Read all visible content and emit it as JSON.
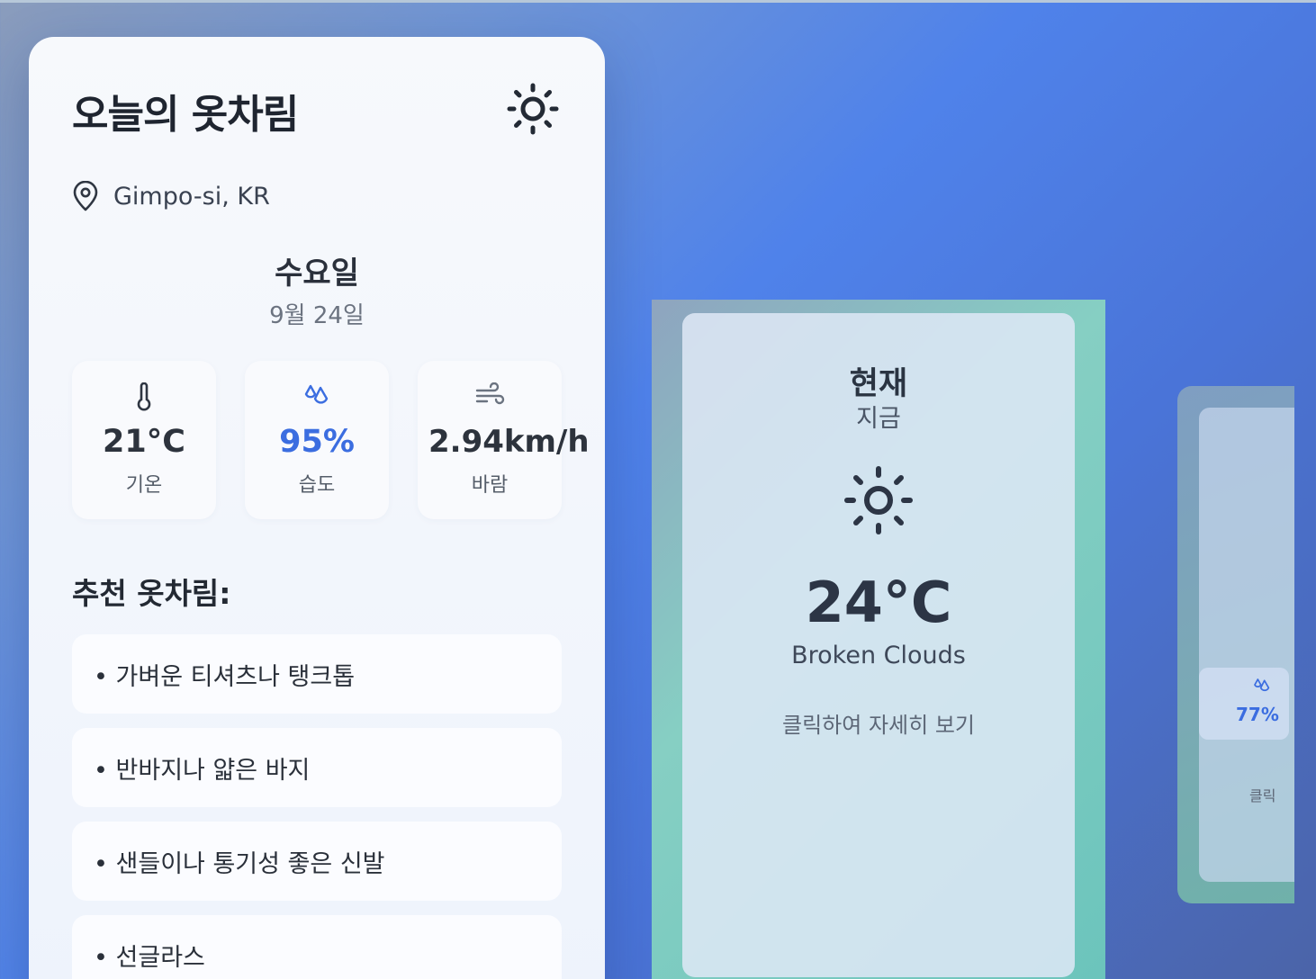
{
  "app": {
    "title": "오늘의 옷차림",
    "theme_icon": "sun-icon"
  },
  "location": {
    "icon": "map-pin-icon",
    "label": "Gimpo-si, KR"
  },
  "day": {
    "weekday": "수요일",
    "date": "9월 24일"
  },
  "stats": [
    {
      "icon": "thermometer-icon",
      "value": "21°C",
      "label": "기온"
    },
    {
      "icon": "droplets-icon",
      "value": "95%",
      "label": "습도"
    },
    {
      "icon": "wind-icon",
      "value": "2.94km/h",
      "label": "바람"
    }
  ],
  "recommendations": {
    "title": "추천 옷차림:",
    "items": [
      "• 가벼운 티셔츠나 탱크톱",
      "• 반바지나 얇은 바지",
      "• 샌들이나 통기성 좋은 신발",
      "• 선글라스"
    ]
  },
  "current_card": {
    "title": "현재",
    "subtitle": "지금",
    "icon": "sun-icon",
    "temp": "24°C",
    "description": "Broken Clouds",
    "hint": "클릭하여 자세히 보기"
  },
  "next_card": {
    "humidity_icon": "droplets-icon",
    "humidity": "77%",
    "hint": "클릭"
  },
  "colors": {
    "accent": "#3b6de0",
    "text": "#1f2530",
    "teal": "#6bc4bc"
  }
}
